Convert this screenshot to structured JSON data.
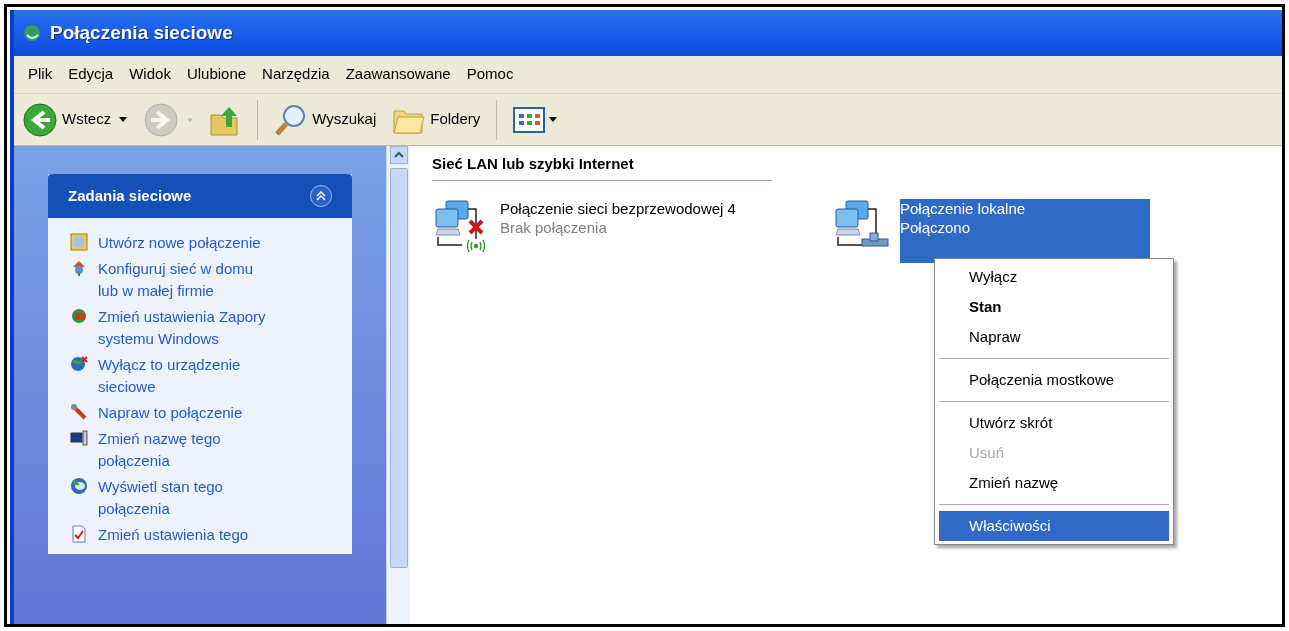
{
  "window": {
    "title": "Połączenia sieciowe"
  },
  "menu_bar": [
    "Plik",
    "Edycja",
    "Widok",
    "Ulubione",
    "Narzędzia",
    "Zaawansowane",
    "Pomoc"
  ],
  "toolbar": {
    "back": {
      "label": "Wstecz",
      "disabled": false
    },
    "forward": {
      "disabled": true
    },
    "search": "Wyszukaj",
    "folders": "Foldery"
  },
  "task_panel": {
    "title": "Zadania sieciowe",
    "expanded": true,
    "items": [
      {
        "label": "Utwórz nowe połączenie"
      },
      {
        "label": "Konfiguruj sieć w domu lub w małej firmie"
      },
      {
        "label": "Zmień ustawienia Zapory systemu Windows"
      },
      {
        "label": "Wyłącz to urządzenie sieciowe"
      },
      {
        "label": "Napraw to połączenie"
      },
      {
        "label": "Zmień nazwę tego połączenia"
      },
      {
        "label": "Wyświetl stan tego połączenia"
      },
      {
        "label": "Zmień ustawienia tego"
      }
    ]
  },
  "group": {
    "title": "Sieć LAN lub szybki Internet",
    "connections": [
      {
        "kind": "wireless",
        "name": "Połączenie sieci bezprzewodowej 4",
        "status": "Brak połączenia",
        "connected": false,
        "selected": false
      },
      {
        "kind": "wired",
        "name": "Połączenie lokalne",
        "status": "Połączono",
        "connected": true,
        "selected": true
      }
    ]
  },
  "context_menu": {
    "items": [
      {
        "kind": "item",
        "label": "Wyłącz",
        "bold": false,
        "disabled": false,
        "selected": false
      },
      {
        "kind": "item",
        "label": "Stan",
        "bold": true,
        "disabled": false,
        "selected": false
      },
      {
        "kind": "item",
        "label": "Napraw",
        "bold": false,
        "disabled": false,
        "selected": false
      },
      {
        "kind": "separator"
      },
      {
        "kind": "item",
        "label": "Połączenia mostkowe",
        "bold": false,
        "disabled": false,
        "selected": false
      },
      {
        "kind": "separator"
      },
      {
        "kind": "item",
        "label": "Utwórz skrót",
        "bold": false,
        "disabled": false,
        "selected": false
      },
      {
        "kind": "item",
        "label": "Usuń",
        "bold": false,
        "disabled": true,
        "selected": false
      },
      {
        "kind": "item",
        "label": "Zmień nazwę",
        "bold": false,
        "disabled": false,
        "selected": false
      },
      {
        "kind": "separator"
      },
      {
        "kind": "item",
        "label": "Właściwości",
        "bold": false,
        "disabled": false,
        "selected": true
      }
    ]
  }
}
